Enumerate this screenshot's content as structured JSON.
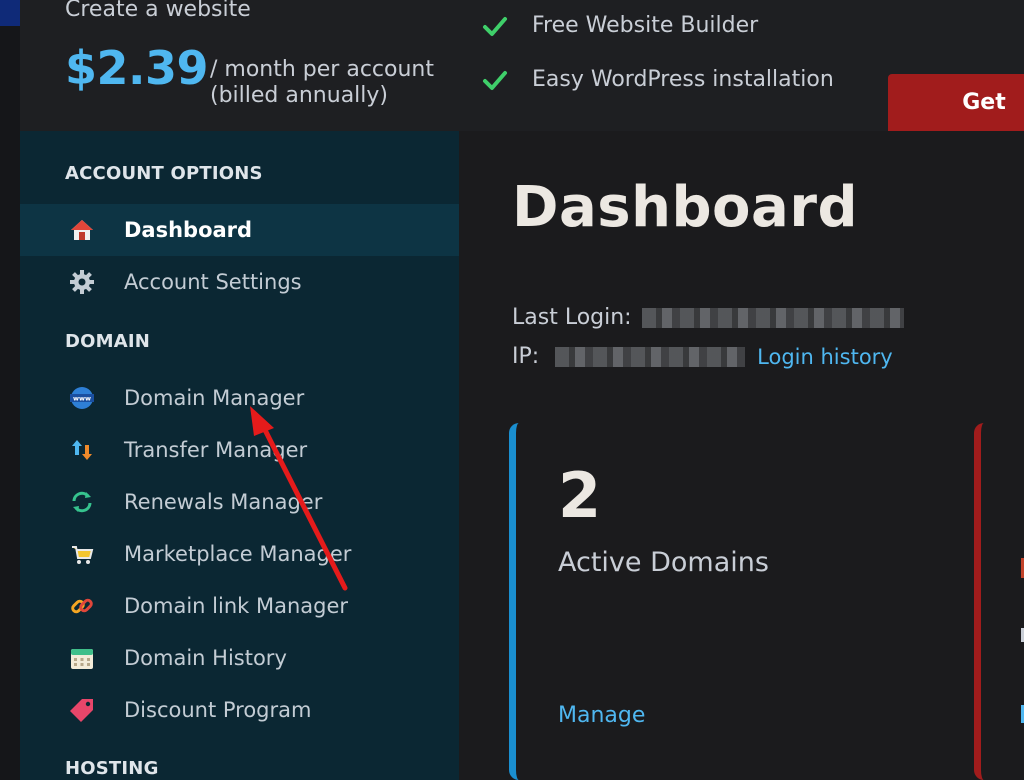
{
  "banner": {
    "title": "Create a website",
    "price": "$2.39",
    "per_line1": "/ month per account",
    "per_line2": "(billed annually)",
    "features": [
      "Free Website Builder",
      "Easy WordPress installation"
    ],
    "cta": "Get"
  },
  "sidebar": {
    "sections": {
      "account": "ACCOUNT OPTIONS",
      "domain": "DOMAIN",
      "hosting": "HOSTING"
    },
    "account_items": [
      {
        "label": "Dashboard",
        "icon": "home-icon",
        "active": true
      },
      {
        "label": "Account Settings",
        "icon": "gear-icon"
      }
    ],
    "domain_items": [
      {
        "label": "Domain Manager",
        "icon": "globe-www-icon"
      },
      {
        "label": "Transfer Manager",
        "icon": "transfer-arrows-icon"
      },
      {
        "label": "Renewals Manager",
        "icon": "refresh-icon"
      },
      {
        "label": "Marketplace Manager",
        "icon": "shopping-cart-icon"
      },
      {
        "label": "Domain link Manager",
        "icon": "chain-link-icon"
      },
      {
        "label": "Domain History",
        "icon": "calendar-icon"
      },
      {
        "label": "Discount Program",
        "icon": "price-tag-icon"
      }
    ]
  },
  "main": {
    "title": "Dashboard",
    "last_login_label": "Last Login:",
    "ip_label": "IP:",
    "login_history": "Login history",
    "cards": [
      {
        "count": "2",
        "label": "Active Domains",
        "link": "Manage"
      }
    ]
  },
  "colors": {
    "accent_blue": "#4fb7f0",
    "sidebar_bg": "#0b2733",
    "cta_red": "#a11c1c",
    "check_green": "#3fcf6a"
  }
}
